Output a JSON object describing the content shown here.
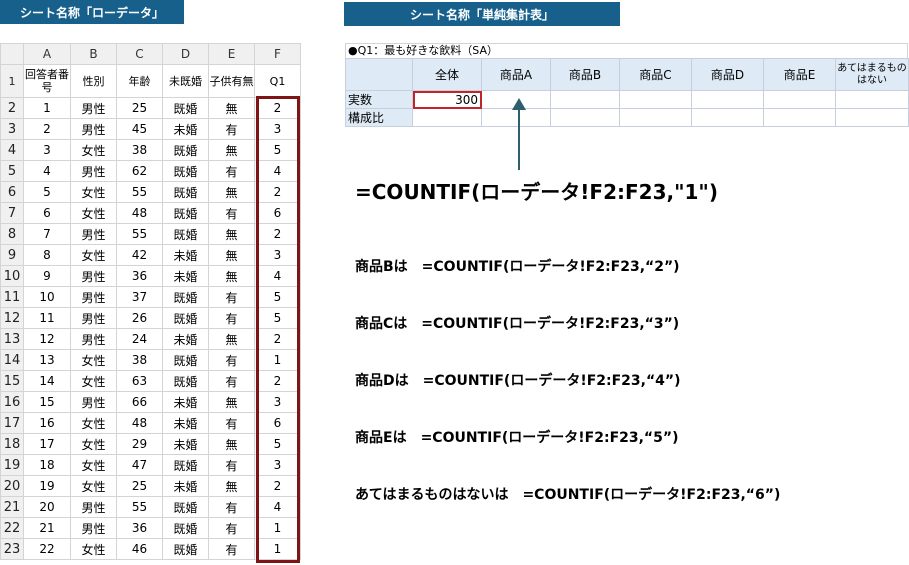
{
  "banners": {
    "left": "シート名称「ローデータ」",
    "right": "シート名称「単純集計表」"
  },
  "raw": {
    "columns": [
      "A",
      "B",
      "C",
      "D",
      "E",
      "F"
    ],
    "header_row": {
      "num": "1",
      "cells": [
        "回答者番号",
        "性別",
        "年齢",
        "未既婚",
        "子供有無",
        "Q1"
      ]
    },
    "rows": [
      {
        "num": "2",
        "cells": [
          "1",
          "男性",
          "25",
          "既婚",
          "無",
          "2"
        ]
      },
      {
        "num": "3",
        "cells": [
          "2",
          "男性",
          "45",
          "未婚",
          "有",
          "3"
        ]
      },
      {
        "num": "4",
        "cells": [
          "3",
          "女性",
          "38",
          "既婚",
          "無",
          "5"
        ]
      },
      {
        "num": "5",
        "cells": [
          "4",
          "男性",
          "62",
          "既婚",
          "有",
          "4"
        ]
      },
      {
        "num": "6",
        "cells": [
          "5",
          "女性",
          "55",
          "既婚",
          "無",
          "2"
        ]
      },
      {
        "num": "7",
        "cells": [
          "6",
          "女性",
          "48",
          "既婚",
          "有",
          "6"
        ]
      },
      {
        "num": "8",
        "cells": [
          "7",
          "男性",
          "55",
          "既婚",
          "無",
          "2"
        ]
      },
      {
        "num": "9",
        "cells": [
          "8",
          "女性",
          "42",
          "未婚",
          "無",
          "3"
        ]
      },
      {
        "num": "10",
        "cells": [
          "9",
          "男性",
          "36",
          "未婚",
          "無",
          "4"
        ]
      },
      {
        "num": "11",
        "cells": [
          "10",
          "男性",
          "37",
          "既婚",
          "有",
          "5"
        ]
      },
      {
        "num": "12",
        "cells": [
          "11",
          "男性",
          "26",
          "既婚",
          "有",
          "5"
        ]
      },
      {
        "num": "13",
        "cells": [
          "12",
          "男性",
          "24",
          "未婚",
          "無",
          "2"
        ]
      },
      {
        "num": "14",
        "cells": [
          "13",
          "女性",
          "38",
          "既婚",
          "有",
          "1"
        ]
      },
      {
        "num": "15",
        "cells": [
          "14",
          "女性",
          "63",
          "既婚",
          "有",
          "2"
        ]
      },
      {
        "num": "16",
        "cells": [
          "15",
          "男性",
          "66",
          "未婚",
          "無",
          "3"
        ]
      },
      {
        "num": "17",
        "cells": [
          "16",
          "女性",
          "48",
          "未婚",
          "有",
          "6"
        ]
      },
      {
        "num": "18",
        "cells": [
          "17",
          "女性",
          "29",
          "未婚",
          "無",
          "5"
        ]
      },
      {
        "num": "19",
        "cells": [
          "18",
          "女性",
          "47",
          "既婚",
          "有",
          "3"
        ]
      },
      {
        "num": "20",
        "cells": [
          "19",
          "女性",
          "25",
          "未婚",
          "無",
          "2"
        ]
      },
      {
        "num": "21",
        "cells": [
          "20",
          "男性",
          "55",
          "既婚",
          "有",
          "4"
        ]
      },
      {
        "num": "22",
        "cells": [
          "21",
          "男性",
          "36",
          "既婚",
          "有",
          "1"
        ]
      },
      {
        "num": "23",
        "cells": [
          "22",
          "女性",
          "46",
          "既婚",
          "有",
          "1"
        ]
      }
    ]
  },
  "summary": {
    "title": "●Q1：最も好きな飲料（SA）",
    "headers": [
      "全体",
      "商品A",
      "商品B",
      "商品C",
      "商品D",
      "商品E",
      "あてはまるものはない"
    ],
    "rows": [
      {
        "label": "実数",
        "values": [
          "300",
          "",
          "",
          "",
          "",
          "",
          ""
        ]
      },
      {
        "label": "構成比",
        "values": [
          "",
          "",
          "",
          "",
          "",
          "",
          ""
        ]
      }
    ]
  },
  "main_formula": "=COUNTIF(ローデータ!F2:F23,\"1\")",
  "formulas": [
    "商品Bは　=COUNTIF(ローデータ!F2:F23,“2”)",
    "商品Cは　=COUNTIF(ローデータ!F2:F23,“3”)",
    "商品Dは　=COUNTIF(ローデータ!F2:F23,“4”)",
    "商品Eは　=COUNTIF(ローデータ!F2:F23,“5”)",
    "あてはまるものはないは　=COUNTIF(ローデータ!F2:F23,“6”)"
  ],
  "colors": {
    "banner": "#17608c",
    "highlight_box": "#7f1416",
    "selected_cell": "#c0252a",
    "header_fill": "#deeaf6"
  }
}
